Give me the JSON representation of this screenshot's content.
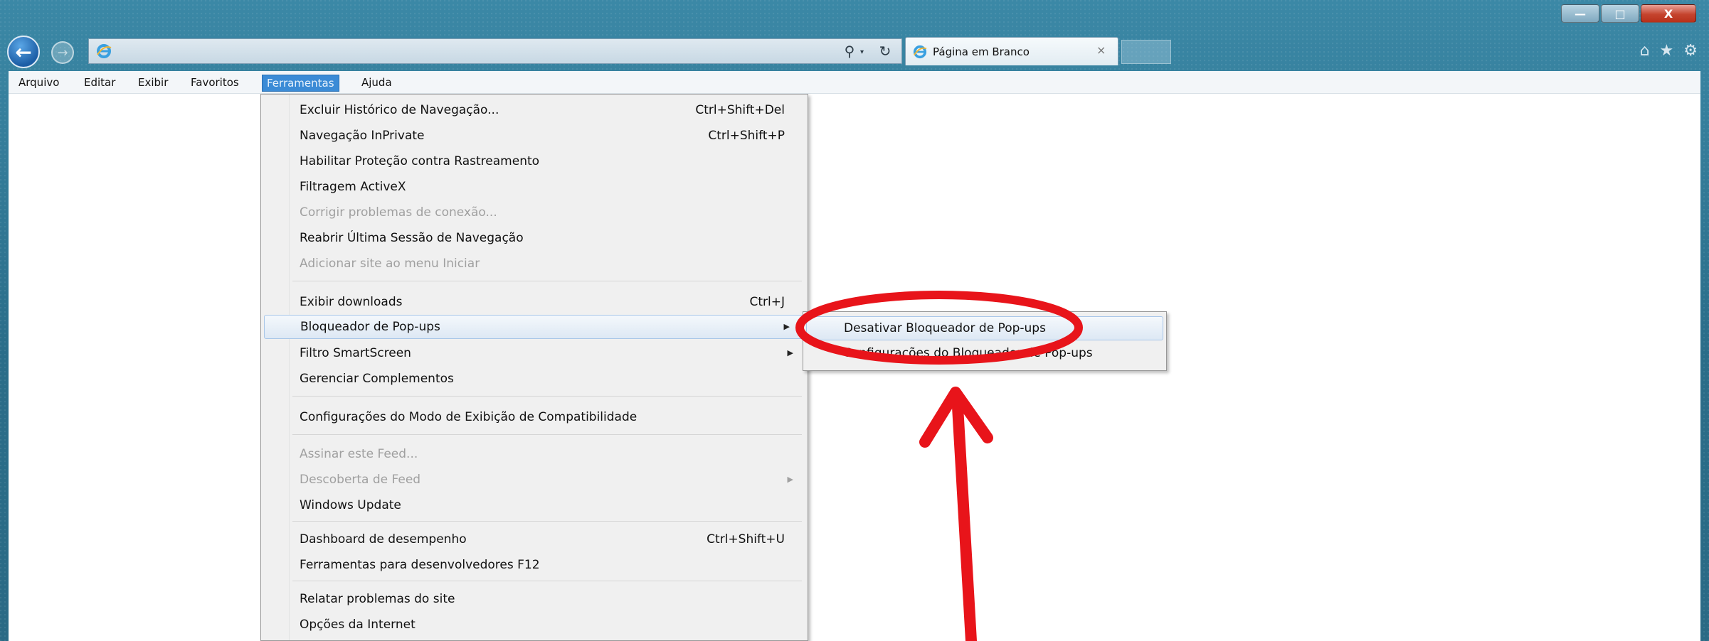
{
  "window": {
    "title": "",
    "caption_buttons": {
      "minimize": "—",
      "maximize": "□",
      "close": "X"
    }
  },
  "nav": {
    "address_text": "",
    "search_icon": "search-icon",
    "dropdown_glyph": "▾",
    "refresh_icon": "refresh-icon",
    "tab_title": "Página em Branco",
    "tab_close": "×",
    "right_icons": [
      "home-icon",
      "favorites-star-icon",
      "settings-gear-icon"
    ]
  },
  "menubar": {
    "items": [
      "Arquivo",
      "Editar",
      "Exibir",
      "Favoritos",
      "Ferramentas",
      "Ajuda"
    ],
    "active": "Ferramentas"
  },
  "tools_menu": {
    "items": [
      {
        "label": "Excluir Histórico de Navegação...",
        "shortcut": "Ctrl+Shift+Del",
        "enabled": true
      },
      {
        "label": "Navegação InPrivate",
        "shortcut": "Ctrl+Shift+P",
        "enabled": true
      },
      {
        "label": "Habilitar Proteção contra Rastreamento",
        "shortcut": "",
        "enabled": true
      },
      {
        "label": "Filtragem ActiveX",
        "shortcut": "",
        "enabled": true
      },
      {
        "label": "Corrigir problemas de conexão...",
        "shortcut": "",
        "enabled": false
      },
      {
        "label": "Reabrir Última Sessão de Navegação",
        "shortcut": "",
        "enabled": true
      },
      {
        "label": "Adicionar site ao menu Iniciar",
        "shortcut": "",
        "enabled": false
      },
      {
        "label": "Exibir downloads",
        "shortcut": "Ctrl+J",
        "enabled": true
      },
      {
        "label": "Bloqueador de Pop-ups",
        "shortcut": "",
        "enabled": true,
        "submenu": true,
        "highlighted": true
      },
      {
        "label": "Filtro SmartScreen",
        "shortcut": "",
        "enabled": true,
        "submenu": true
      },
      {
        "label": "Gerenciar Complementos",
        "shortcut": "",
        "enabled": true
      },
      {
        "label": "Configurações do Modo de Exibição de Compatibilidade",
        "shortcut": "",
        "enabled": true
      },
      {
        "label": "Assinar este Feed...",
        "shortcut": "",
        "enabled": false
      },
      {
        "label": "Descoberta de Feed",
        "shortcut": "",
        "enabled": false,
        "submenu": true
      },
      {
        "label": "Windows Update",
        "shortcut": "",
        "enabled": true
      },
      {
        "label": "Dashboard de desempenho",
        "shortcut": "Ctrl+Shift+U",
        "enabled": true
      },
      {
        "label": "Ferramentas para desenvolvedores F12",
        "shortcut": "",
        "enabled": true
      },
      {
        "label": "Relatar problemas do site",
        "shortcut": "",
        "enabled": true
      },
      {
        "label": "Opções da Internet",
        "shortcut": "",
        "enabled": true
      }
    ]
  },
  "popup_submenu": {
    "items": [
      {
        "label": "Desativar Bloqueador de Pop-ups",
        "highlighted": true
      },
      {
        "label": "Configurações do Bloqueador de Pop-ups",
        "highlighted": false
      }
    ]
  },
  "annotation": {
    "color": "#e8141a",
    "shapes": [
      "ellipse-highlight",
      "arrow-up"
    ]
  }
}
